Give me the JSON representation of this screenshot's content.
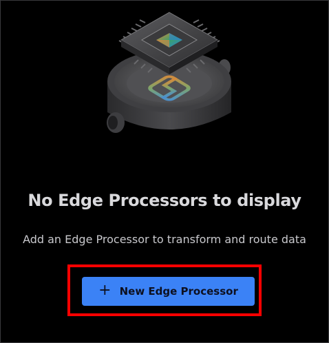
{
  "empty_state": {
    "illustration_icon": "edge-processor-chip-icon",
    "title": "No Edge Processors to display",
    "subtitle": "Add an Edge Processor to transform and route data"
  },
  "actions": {
    "new_button_icon": "+",
    "new_button_label": "New Edge Processor"
  },
  "colors": {
    "background": "#000000",
    "title_text": "#d9d9dc",
    "button_bg": "#3b82f6",
    "button_text": "#0d1020",
    "highlight_border": "#ff0000"
  }
}
